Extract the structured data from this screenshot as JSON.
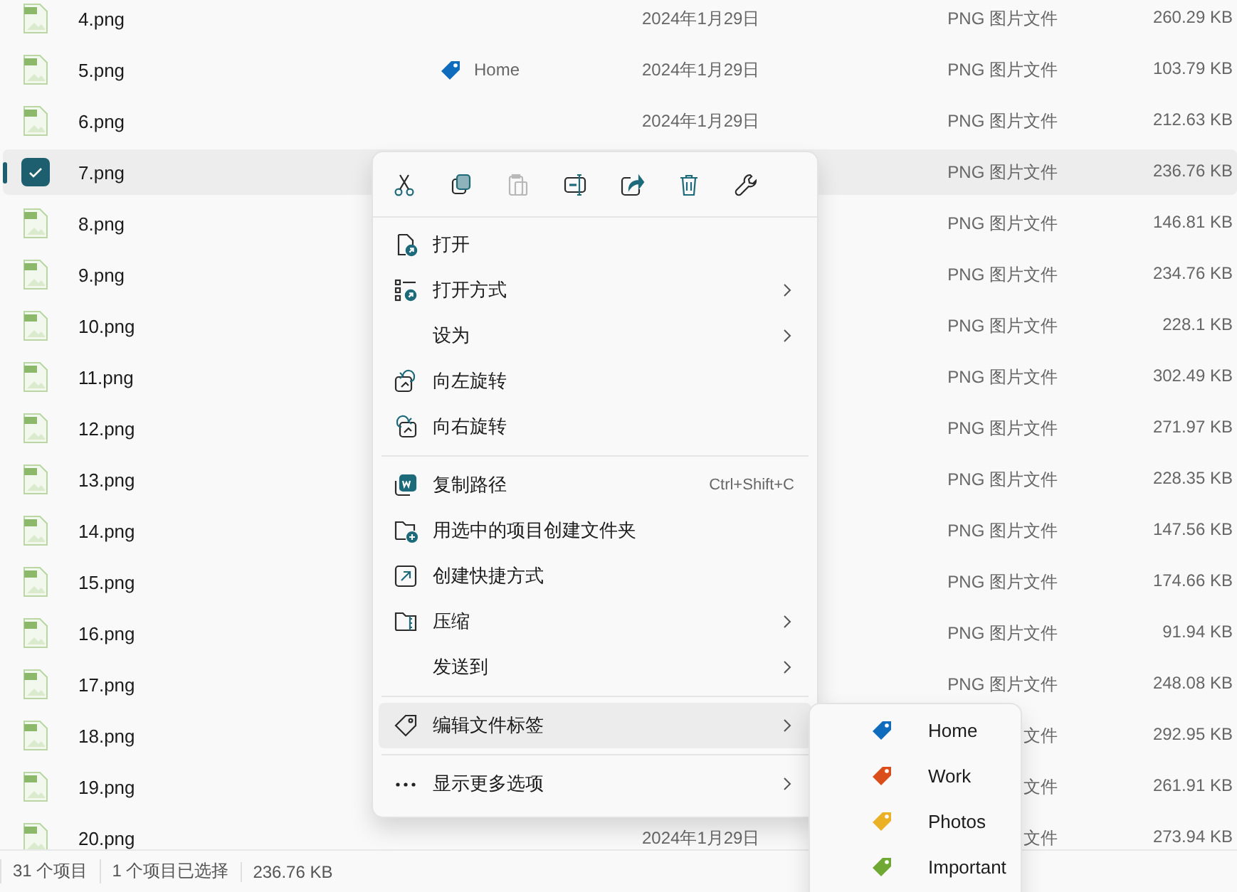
{
  "files": [
    {
      "name": "4.png",
      "date": "2024年1月29日",
      "type": "PNG 图片文件",
      "size": "260.29 KB",
      "selected": false
    },
    {
      "name": "5.png",
      "tag": {
        "label": "Home",
        "color": "#0f6cbd"
      },
      "date": "2024年1月29日",
      "type": "PNG 图片文件",
      "size": "103.79 KB",
      "selected": false
    },
    {
      "name": "6.png",
      "date": "2024年1月29日",
      "type": "PNG 图片文件",
      "size": "212.63 KB",
      "selected": false
    },
    {
      "name": "7.png",
      "type": "PNG 图片文件",
      "size": "236.76 KB",
      "selected": true
    },
    {
      "name": "8.png",
      "type": "PNG 图片文件",
      "size": "146.81 KB",
      "selected": false
    },
    {
      "name": "9.png",
      "type": "PNG 图片文件",
      "size": "234.76 KB",
      "selected": false
    },
    {
      "name": "10.png",
      "type": "PNG 图片文件",
      "size": "228.1 KB",
      "selected": false
    },
    {
      "name": "11.png",
      "type": "PNG 图片文件",
      "size": "302.49 KB",
      "selected": false
    },
    {
      "name": "12.png",
      "type": "PNG 图片文件",
      "size": "271.97 KB",
      "selected": false
    },
    {
      "name": "13.png",
      "type": "PNG 图片文件",
      "size": "228.35 KB",
      "selected": false
    },
    {
      "name": "14.png",
      "type": "PNG 图片文件",
      "size": "147.56 KB",
      "selected": false
    },
    {
      "name": "15.png",
      "type": "PNG 图片文件",
      "size": "174.66 KB",
      "selected": false
    },
    {
      "name": "16.png",
      "type": "PNG 图片文件",
      "size": "91.94 KB",
      "selected": false
    },
    {
      "name": "17.png",
      "type": "PNG 图片文件",
      "size": "248.08 KB",
      "selected": false
    },
    {
      "name": "18.png",
      "type": "文件",
      "size": "292.95 KB",
      "selected": false
    },
    {
      "name": "19.png",
      "type": "文件",
      "size": "261.91 KB",
      "selected": false
    },
    {
      "name": "20.png",
      "date": "2024年1月29日",
      "type": "文件",
      "size": "273.94 KB",
      "selected": false
    }
  ],
  "context_menu": {
    "toolbar": [
      {
        "kind": "cut",
        "disabled": false
      },
      {
        "kind": "copy",
        "disabled": false
      },
      {
        "kind": "paste",
        "disabled": true
      },
      {
        "kind": "rename",
        "disabled": false
      },
      {
        "kind": "share",
        "disabled": false
      },
      {
        "kind": "delete",
        "disabled": false
      },
      {
        "kind": "properties",
        "disabled": false
      }
    ],
    "groups": [
      [
        {
          "kind": "open",
          "label": "打开",
          "submenu": false,
          "highlighted": false
        },
        {
          "kind": "open-with",
          "label": "打开方式",
          "submenu": true,
          "highlighted": false
        },
        {
          "kind": "none",
          "label": "设为",
          "submenu": true,
          "highlighted": false
        },
        {
          "kind": "rotate-left",
          "label": "向左旋转",
          "submenu": false,
          "highlighted": false
        },
        {
          "kind": "rotate-right",
          "label": "向右旋转",
          "submenu": false,
          "highlighted": false
        }
      ],
      [
        {
          "kind": "copy-path",
          "label": "复制路径",
          "shortcut": "Ctrl+Shift+C",
          "submenu": false,
          "highlighted": false
        },
        {
          "kind": "new-folder",
          "label": "用选中的项目创建文件夹",
          "submenu": false,
          "highlighted": false
        },
        {
          "kind": "shortcut",
          "label": "创建快捷方式",
          "submenu": false,
          "highlighted": false
        },
        {
          "kind": "compress",
          "label": "压缩",
          "submenu": true,
          "highlighted": false
        },
        {
          "kind": "none",
          "label": "发送到",
          "submenu": true,
          "highlighted": false
        }
      ],
      [
        {
          "kind": "tag",
          "label": "编辑文件标签",
          "submenu": true,
          "highlighted": true
        }
      ],
      [
        {
          "kind": "more",
          "label": "显示更多选项",
          "submenu": true,
          "highlighted": false
        }
      ]
    ]
  },
  "tag_menu": [
    {
      "label": "Home",
      "color": "#0f6cbd"
    },
    {
      "label": "Work",
      "color": "#da4e1c"
    },
    {
      "label": "Photos",
      "color": "#eab026"
    },
    {
      "label": "Important",
      "color": "#6fa832"
    }
  ],
  "status_bar": [
    "31 个项目",
    "1 个项目已选择",
    "236.76 KB"
  ]
}
